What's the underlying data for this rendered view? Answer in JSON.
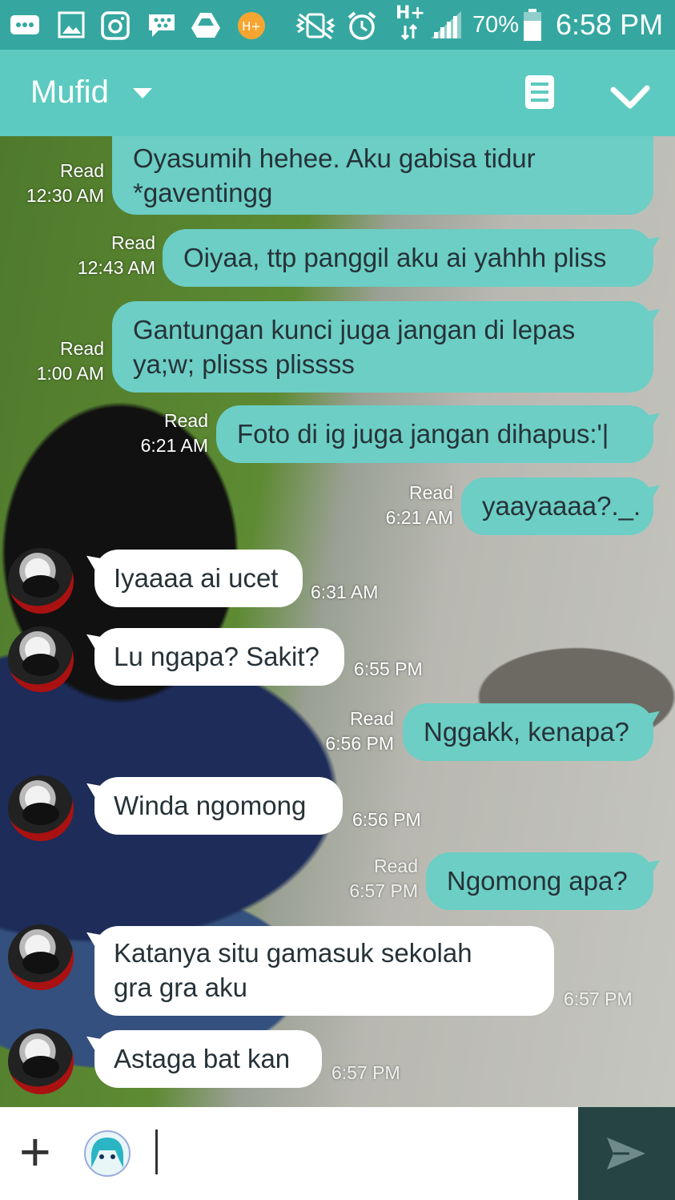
{
  "status": {
    "signal": "H+",
    "battery": "70%",
    "time": "6:58 PM"
  },
  "header": {
    "contact": "Mufid",
    "icons": [
      "chevron-down-icon",
      "notes-icon",
      "check-icon"
    ]
  },
  "colors": {
    "status_bar": "#35a7a0",
    "header": "#5ccac0",
    "sent_bubble": "#6ccec5",
    "received_bubble": "#ffffff",
    "send_button": "#264444"
  },
  "messages": [
    {
      "direction": "sent",
      "text": "Oyasumih hehee. Aku gabisa tidur\n*gaventingg",
      "read": "Read",
      "time": "12:30 AM"
    },
    {
      "direction": "sent",
      "text": "Oiyaa, ttp panggil aku ai yahhh pliss",
      "read": "Read",
      "time": "12:43 AM"
    },
    {
      "direction": "sent",
      "text": "Gantungan kunci juga jangan di lepas\nya;w; plisss plissss",
      "read": "Read",
      "time": "1:00 AM"
    },
    {
      "direction": "sent",
      "text": "Foto di ig juga jangan dihapus:'|",
      "read": "Read",
      "time": "6:21 AM"
    },
    {
      "direction": "sent",
      "text": "yaayaaaa?._.",
      "read": "Read",
      "time": "6:21 AM"
    },
    {
      "direction": "received",
      "text": "Iyaaaa ai ucet",
      "time": "6:31 AM"
    },
    {
      "direction": "received",
      "text": "Lu ngapa? Sakit?",
      "time": "6:55 PM"
    },
    {
      "direction": "sent",
      "text": "Nggakk, kenapa?",
      "read": "Read",
      "time": "6:56 PM"
    },
    {
      "direction": "received",
      "text": "Winda ngomong",
      "time": "6:56 PM"
    },
    {
      "direction": "sent",
      "text": "Ngomong apa?",
      "read": "Read",
      "time": "6:57 PM"
    },
    {
      "direction": "received",
      "text": "Katanya situ gamasuk sekolah\ngra gra aku",
      "time": "6:57 PM"
    },
    {
      "direction": "received",
      "text": "Astaga bat kan",
      "time": "6:57 PM"
    }
  ],
  "input": {
    "add": "+",
    "value": ""
  }
}
